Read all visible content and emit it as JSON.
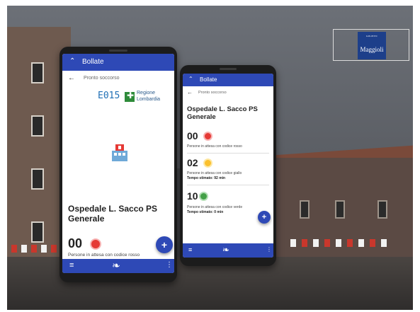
{
  "branding": {
    "group_label": "GRUPPO",
    "name": "Maggioli",
    "logo_color": "#1d3f8a"
  },
  "accent_color": "#2e49b6",
  "phone_large": {
    "app_title": "Bollate",
    "breadcrumb": "Pronto soccorso",
    "logo_e015": "E015",
    "logo_regione": "Regione",
    "logo_lombardia": "Lombardia",
    "hospital_name": "Ospedale L. Sacco PS Generale",
    "entries": [
      {
        "count": "00",
        "color": "#e53935",
        "label": "Persone in attesa con codice rosso"
      }
    ],
    "fab_label": "+",
    "icons": [
      "menu-icon",
      "bird-icon",
      "more-icon"
    ]
  },
  "phone_small": {
    "app_title": "Bollate",
    "breadcrumb": "Pronto soccorso",
    "hospital_name": "Ospedale L. Sacco PS Generale",
    "entries": [
      {
        "count": "00",
        "color": "#e53935",
        "label": "Persone in attesa con codice rosso",
        "wait": ""
      },
      {
        "count": "02",
        "color": "#fbc02d",
        "label": "Persone in attesa con codice giallo",
        "wait": "Tempo stimato: 92 min"
      },
      {
        "count": "10",
        "color": "#43a047",
        "label": "Persone in attesa con codice verde",
        "wait": "Tempo stimato: 0 min"
      }
    ],
    "fab_label": "+",
    "icons": [
      "menu-icon",
      "bird-icon",
      "more-icon"
    ]
  }
}
